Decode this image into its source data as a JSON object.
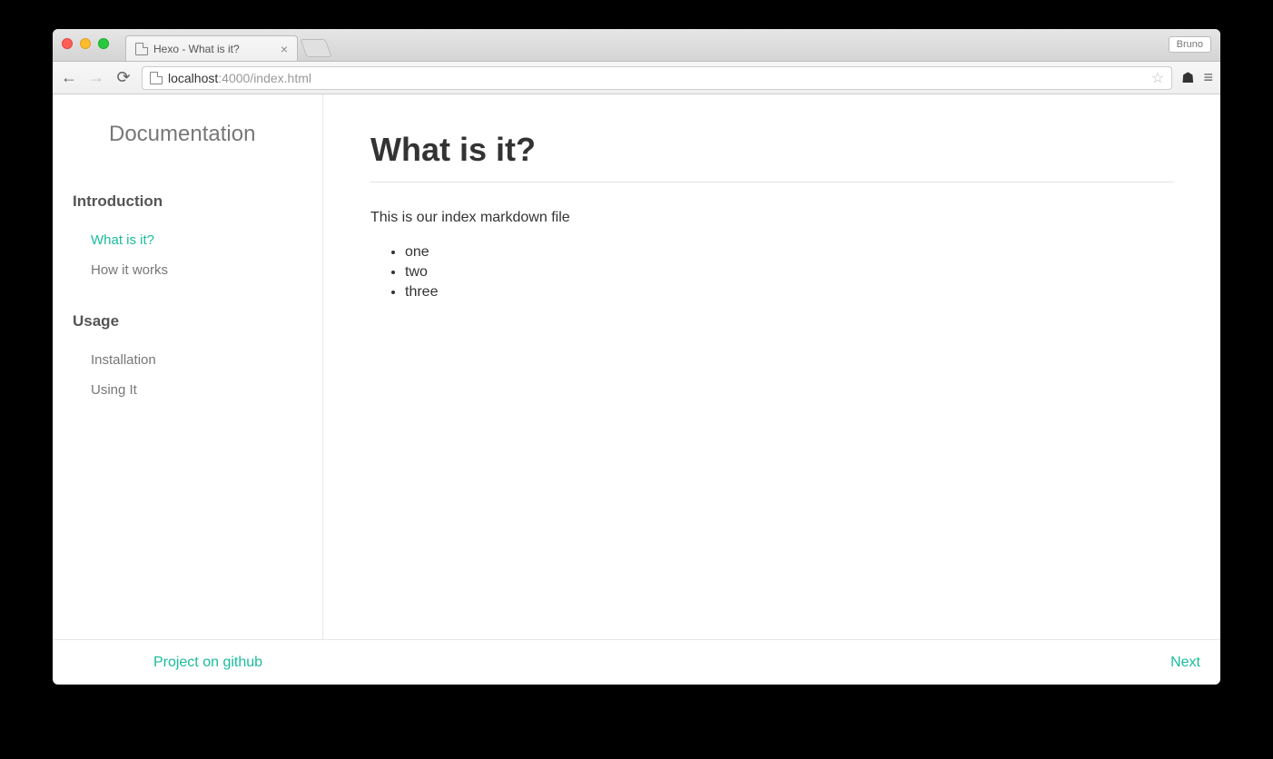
{
  "browser": {
    "tab_title": "Hexo - What is it?",
    "profile": "Bruno",
    "url_host_dark": "localhost",
    "url_rest": ":4000/index.html"
  },
  "sidebar": {
    "title": "Documentation",
    "sections": [
      {
        "title": "Introduction",
        "items": [
          "What is it?",
          "How it works"
        ]
      },
      {
        "title": "Usage",
        "items": [
          "Installation",
          "Using It"
        ]
      }
    ]
  },
  "main": {
    "title": "What is it?",
    "intro": "This is our index markdown file",
    "list": [
      "one",
      "two",
      "three"
    ]
  },
  "footer": {
    "left": "Project on github",
    "right": "Next"
  },
  "colors": {
    "accent": "#1abc9c"
  }
}
